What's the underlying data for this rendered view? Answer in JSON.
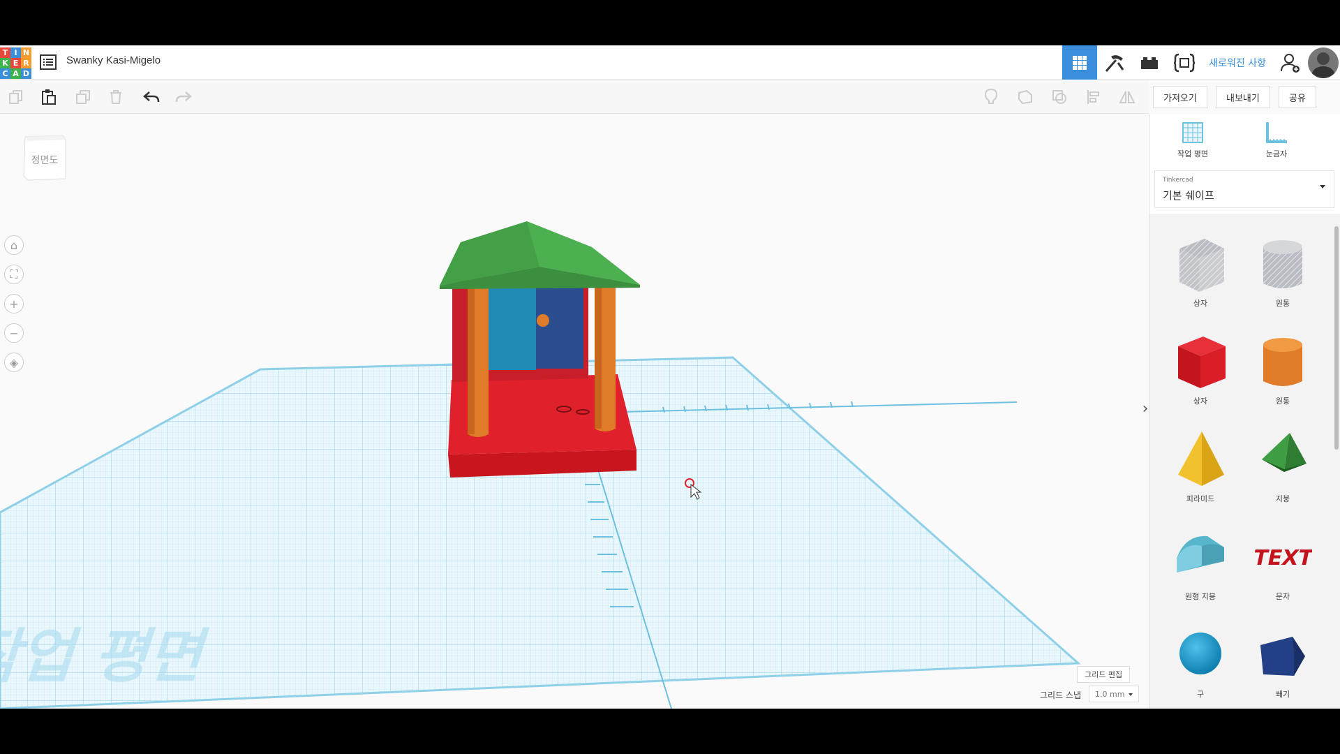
{
  "logo": {
    "letters": [
      "T",
      "I",
      "N",
      "K",
      "E",
      "R",
      "C",
      "A",
      "D"
    ],
    "colors": [
      "#e8473b",
      "#3b8fd9",
      "#f39b2d",
      "#3cb44b",
      "#e8473b",
      "#f39b2d",
      "#3b8fd9",
      "#3cb44b",
      "#3b8fd9"
    ]
  },
  "header": {
    "design_title": "Swanky Kasi-Migelo",
    "whats_new": "새로워진 사항",
    "icons": [
      "3d-view-icon",
      "build-hammer-icon",
      "bricks-icon",
      "codeblocks-icon"
    ]
  },
  "toolbar": {
    "import_label": "가져오기",
    "export_label": "내보내기",
    "share_label": "공유"
  },
  "viewcube": {
    "label": "정면도"
  },
  "sidebar": {
    "workplane_label": "작업 평면",
    "ruler_label": "눈금자",
    "library_source": "Tinkercad",
    "library_selected": "기본 쉐이프",
    "shapes": [
      {
        "label": "상자",
        "icon": "box-hole-icon"
      },
      {
        "label": "원통",
        "icon": "cylinder-hole-icon"
      },
      {
        "label": "상자",
        "icon": "box-icon"
      },
      {
        "label": "원통",
        "icon": "cylinder-icon"
      },
      {
        "label": "피라미드",
        "icon": "pyramid-icon"
      },
      {
        "label": "지붕",
        "icon": "roof-icon"
      },
      {
        "label": "원형 지붕",
        "icon": "round-roof-icon"
      },
      {
        "label": "문자",
        "icon": "text-icon"
      },
      {
        "label": "구",
        "icon": "sphere-icon"
      },
      {
        "label": "쐐기",
        "icon": "wedge-icon"
      }
    ]
  },
  "workplane": {
    "watermark": "작업 평면",
    "grid_edit_label": "그리드 편집",
    "snap_label": "그리드 스냅",
    "snap_value": "1.0 mm"
  },
  "colors": {
    "accent": "#3a8edc",
    "grid": "#a9dcef",
    "roof": "#4caf50",
    "base": "#e0212b",
    "pillar": "#e07b2a",
    "door_left": "#1f8bb5",
    "door_right": "#2b4f8e"
  }
}
